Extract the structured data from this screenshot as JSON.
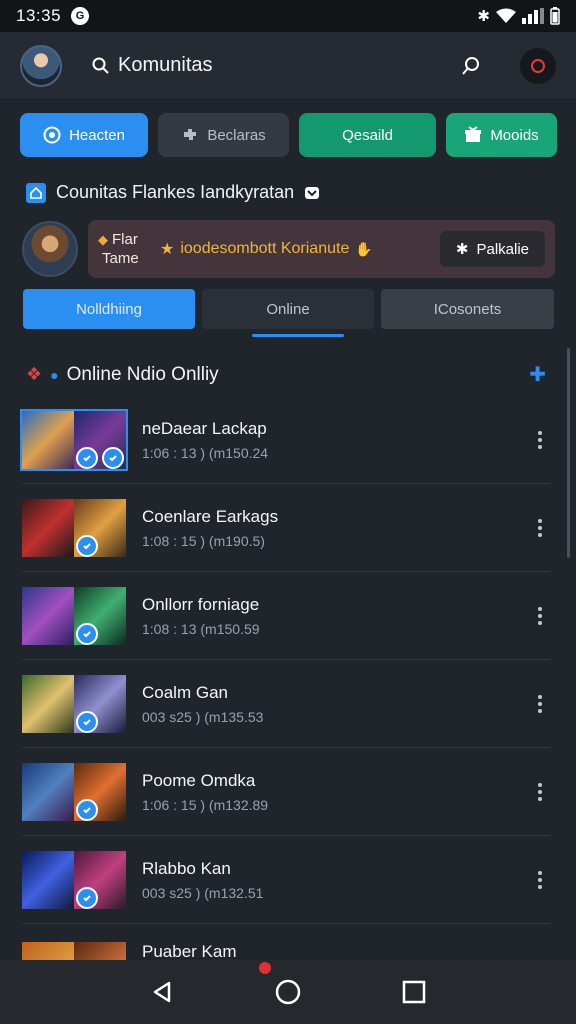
{
  "status": {
    "time": "13:35",
    "app_badge": "G"
  },
  "header": {
    "title": "Komunitas"
  },
  "actions": [
    {
      "label": "Heacten",
      "icon": "target-icon"
    },
    {
      "label": "Beclaras",
      "icon": "puzzle-icon"
    },
    {
      "label": "Qesaild",
      "icon": ""
    },
    {
      "label": "Mooids",
      "icon": "gift-icon"
    }
  ],
  "section": {
    "title": "Counitas Flankes Iandkyratan"
  },
  "profile": {
    "name_line1": "Flar",
    "name_line2": "Tame",
    "tag": "ioodesombott Korianute",
    "follow_label": "Palkalie"
  },
  "tabs": [
    {
      "label": "Nolldhiing"
    },
    {
      "label": "Online"
    },
    {
      "label": "ICosonets"
    }
  ],
  "list_header": {
    "title": "Online Ndio Onlliy"
  },
  "items": [
    {
      "title": "neDaear Lackap",
      "sub": "1:06 : 13 ) (m150.24"
    },
    {
      "title": "Coenlare Earkags",
      "sub": "1:08 : 15 ) (m190.5)"
    },
    {
      "title": "Onllorr forniage",
      "sub": "1:08 : 13 (m150.59"
    },
    {
      "title": "Coalm Gan",
      "sub": "003 s25 ) (m135.53"
    },
    {
      "title": "Poome Omdka",
      "sub": "1:06 : 15 ) (m132.89"
    },
    {
      "title": "Rlabbo Kan",
      "sub": "003 s25 ) (m132.51"
    },
    {
      "title": "Puaber Kam",
      "sub": ""
    }
  ],
  "colors": {
    "accent": "#2a8ff0",
    "green": "#14996e",
    "background": "#20242b"
  }
}
